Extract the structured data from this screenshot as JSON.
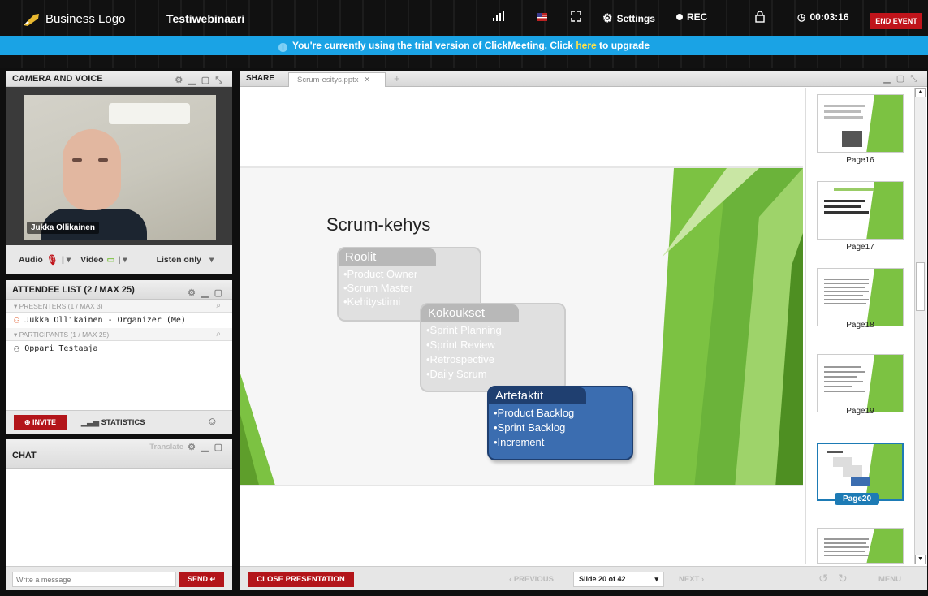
{
  "topbar": {
    "logo_text": "Business Logo",
    "webinar_title": "Testiwebinaari",
    "settings_label": "Settings",
    "rec_label": "REC",
    "timer": "00:03:16",
    "end_event_label": "END EVENT"
  },
  "banner": {
    "text_before": "You're currently using the trial version of ClickMeeting. Click ",
    "link_text": "here",
    "text_after": " to upgrade"
  },
  "camera": {
    "title": "CAMERA AND VOICE",
    "person_name": "Jukka Ollikainen",
    "audio_label": "Audio",
    "video_label": "Video",
    "listen_label": "Listen only"
  },
  "attendees": {
    "title": "ATTENDEE LIST  (2 / MAX 25)",
    "presenters_header": "PRESENTERS (1 / MAX 3)",
    "presenters": [
      "Jukka Ollikainen - Organizer (Me)"
    ],
    "participants_header": "PARTICIPANTS (1 / MAX 25)",
    "participants": [
      "Oppari Testaaja"
    ],
    "invite_label": "INVITE",
    "statistics_label": "STATISTICS"
  },
  "chat": {
    "title": "CHAT",
    "translate_label": "Translate",
    "input_placeholder": "Write a message",
    "send_label": "SEND"
  },
  "share": {
    "share_label": "SHARE",
    "tab_name": "Scrum-esitys.pptx",
    "close_presentation_label": "CLOSE PRESENTATION",
    "previous_label": "PREVIOUS",
    "slide_selector": "Slide 20 of 42",
    "next_label": "NEXT",
    "menu_label": "MENU"
  },
  "slide": {
    "title": "Scrum-kehys",
    "box1_title": "Roolit",
    "box1_items": [
      "•Product Owner",
      "•Scrum Master",
      "•Kehitystiimi"
    ],
    "box2_title": "Kokoukset",
    "box2_items": [
      "•Sprint Planning",
      "•Sprint Review",
      "•Retrospective",
      "•Daily Scrum"
    ],
    "box3_title": "Artefaktit",
    "box3_items": [
      "•Product Backlog",
      "•Sprint Backlog",
      "•Increment"
    ]
  },
  "thumbnails": [
    {
      "label": "Page16"
    },
    {
      "label": "Page17"
    },
    {
      "label": "Page18"
    },
    {
      "label": "Page19"
    },
    {
      "label": "Page20"
    }
  ],
  "colors": {
    "accent_blue": "#1aa3e5",
    "brand_red": "#c0141b",
    "slide_green": "#7cc242",
    "artefaktit_blue": "#2f5f9e"
  }
}
